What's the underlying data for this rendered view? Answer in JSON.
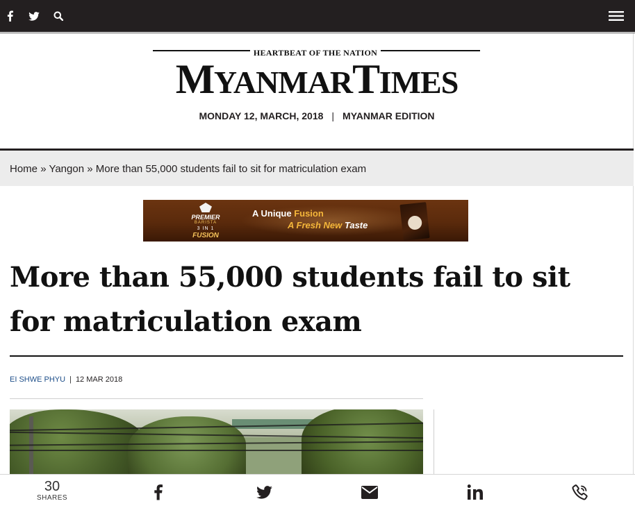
{
  "topbar": {
    "icons": {
      "facebook": "facebook-icon",
      "twitter": "twitter-icon",
      "search": "search-icon",
      "menu": "hamburger-menu-icon"
    }
  },
  "masthead": {
    "tagline": "HEARTBEAT OF THE NATION",
    "logo_parts": [
      "M",
      "YANMAR",
      "T",
      "IMES"
    ],
    "date": "MONDAY 12, MARCH, 2018",
    "separator": "|",
    "edition": "MYANMAR EDITION"
  },
  "breadcrumb": {
    "home": "Home",
    "sep": "»",
    "section": "Yangon",
    "current": "More than 55,000 students fail to sit for matriculation exam"
  },
  "ad": {
    "brand_top": "PREMIER",
    "brand_mid": "BARISTA",
    "brand_sub": "3 IN 1",
    "brand_product": "FUSION",
    "line1_a": "A Unique ",
    "line1_b": "Fusion",
    "line2_a": "A Fresh ",
    "line2_b": "New",
    "line2_c": " Taste"
  },
  "article": {
    "headline": "More than 55,000 students fail to sit for matriculation exam",
    "author": "EI SHWE PHYU",
    "byline_sep": "|",
    "date": "12 MAR 2018"
  },
  "sharebar": {
    "count": "30",
    "count_label": "SHARES",
    "icons": [
      "facebook-icon",
      "twitter-icon",
      "email-icon",
      "linkedin-icon",
      "phone-icon"
    ]
  },
  "colors": {
    "topbar_bg": "#231f20",
    "author_link": "#1d4e89",
    "breadcrumb_bg": "#ececec",
    "ad_accent": "#f4b63a"
  }
}
